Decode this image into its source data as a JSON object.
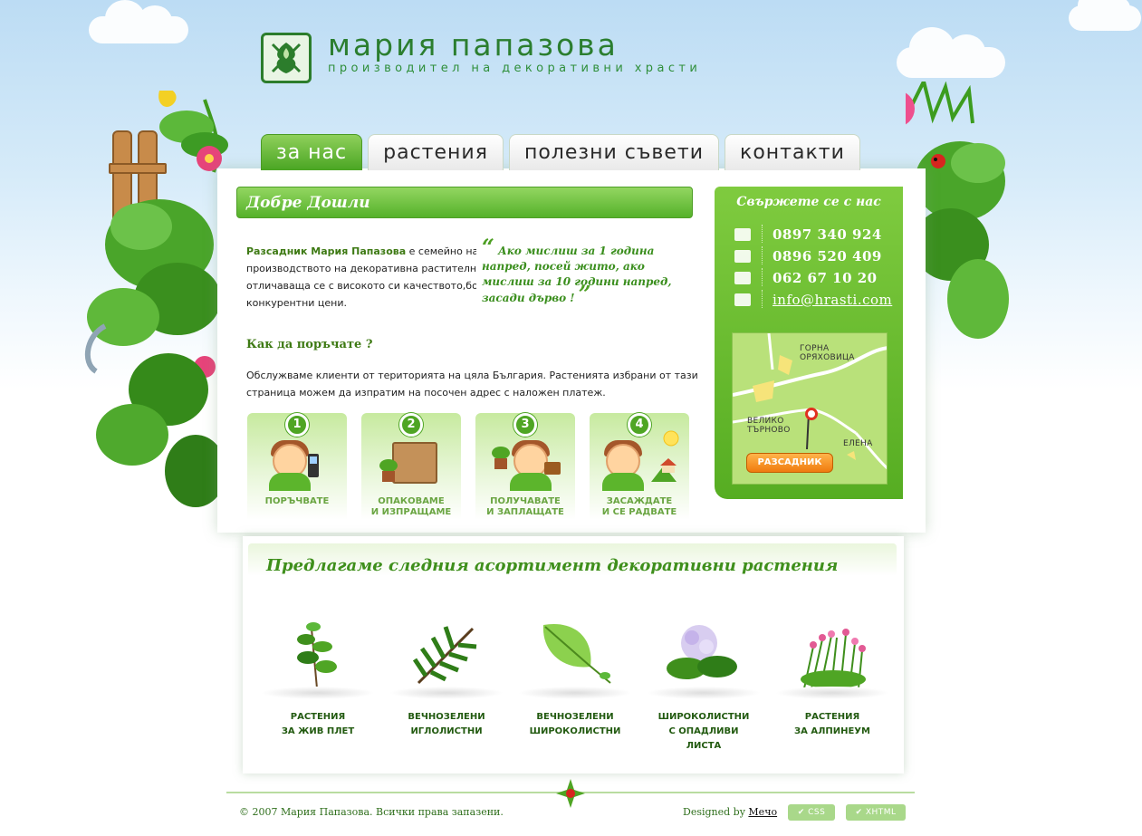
{
  "brand": {
    "name": "мария папазова",
    "tagline": "производител на декоративни храсти"
  },
  "nav": {
    "tabs": [
      {
        "label": "за нас",
        "active": true
      },
      {
        "label": "растения",
        "active": false
      },
      {
        "label": "полезни съвети",
        "active": false
      },
      {
        "label": "контакти",
        "active": false
      }
    ]
  },
  "welcome": {
    "title": "Добре Дошли",
    "intro_strong": "Разсадник Мария Папазова",
    "intro_rest": " е семейно начинание специализирано в производството на декоративна растителност, изцяло собствена продукция отличаваща се с високото си качеството,богато видово разнообразие и конкурентни цени.",
    "quote": "Ако мислиш за 1 година напред, посей жито, ако мислиш за 10 години напред, засади дърво !"
  },
  "order": {
    "heading": "Как да поръчате ?",
    "text": "Обслужваме клиенти от територията на цяла България. Растенията избрани от тази страница можем да изпратим на посочен адрес с наложен платеж.",
    "steps": [
      {
        "num": "1",
        "label_line1": "ПОРЪЧВАТЕ",
        "label_line2": ""
      },
      {
        "num": "2",
        "label_line1": "ОПАКОВАМЕ",
        "label_line2": "И ИЗПРАЩАМЕ"
      },
      {
        "num": "3",
        "label_line1": "ПОЛУЧАВАТЕ",
        "label_line2": "И ЗАПЛАЩАТЕ"
      },
      {
        "num": "4",
        "label_line1": "ЗАСАЖДАТЕ",
        "label_line2": "И СЕ РАДВАТЕ"
      }
    ]
  },
  "contact": {
    "title": "Свържете се с нас",
    "phone1": "0897 340 924",
    "phone2": "0896 520 409",
    "phone3": "062 67 10 20",
    "email": "info@hrasti.com",
    "map": {
      "label_gorna_1": "ГОРНА",
      "label_gorna_2": "ОРЯХОВИЦА",
      "label_veliko_1": "ВЕЛИКО",
      "label_veliko_2": "ТЪРНОВО",
      "label_elena": "ЕЛЕНА",
      "badge": "РАЗСАДНИК"
    }
  },
  "assortment": {
    "heading": "Предлагаме следния асортимент декоративни растения",
    "items": [
      {
        "line1": "РАСТЕНИЯ",
        "line2": "ЗА ЖИВ ПЛЕТ",
        "line3": ""
      },
      {
        "line1": "ВЕЧНОЗЕЛЕНИ",
        "line2": "ИГЛОЛИСТНИ",
        "line3": ""
      },
      {
        "line1": "ВЕЧНОЗЕЛЕНИ",
        "line2": "ШИРОКОЛИСТНИ",
        "line3": ""
      },
      {
        "line1": "ШИРОКОЛИСТНИ",
        "line2": "С ОПАДЛИВИ",
        "line3": "ЛИСТА"
      },
      {
        "line1": "РАСТЕНИЯ",
        "line2": "ЗА АЛПИНЕУМ",
        "line3": ""
      }
    ]
  },
  "footer": {
    "copyright": "© 2007 Мария Папазова. Всички права запазени.",
    "designed_prefix": "Designed by ",
    "designer": "Мечо",
    "badge_css": "CSS",
    "badge_xhtml": "XHTML"
  },
  "colors": {
    "accent_green": "#56ad22",
    "title_green": "#2b7e2f",
    "sky": "#bcdcf4"
  }
}
